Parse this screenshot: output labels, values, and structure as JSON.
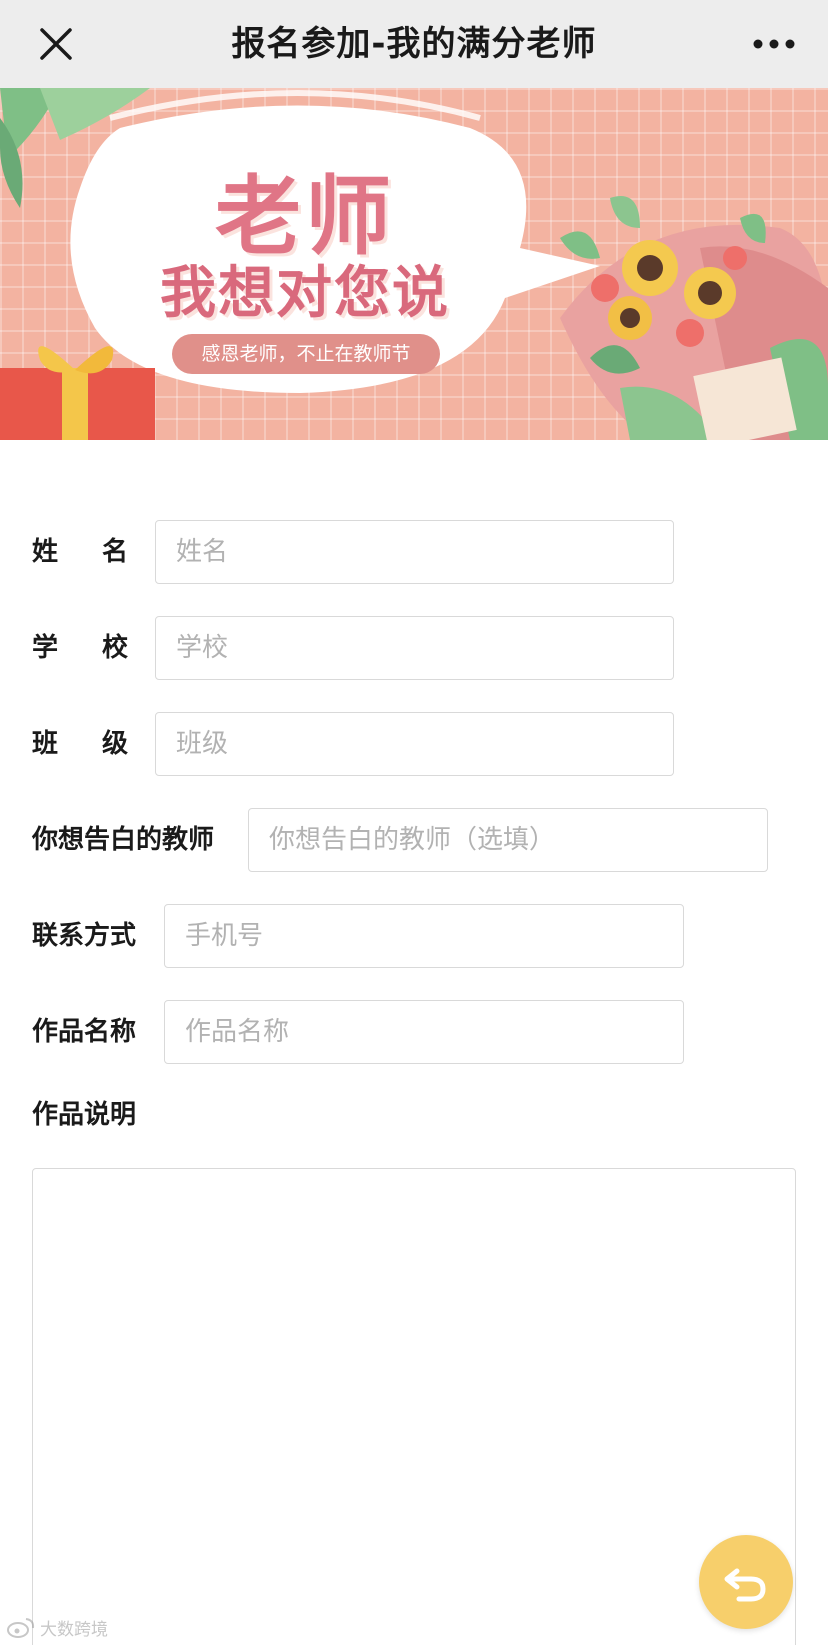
{
  "nav": {
    "title": "报名参加-我的满分老师",
    "close_icon": "close-icon",
    "more_icon": "more-dots-icon"
  },
  "banner": {
    "title": "老师",
    "subtitle": "我想对您说",
    "tagline": "感恩老师，不止在教师节",
    "colors": {
      "background": "#f3b3a1",
      "title": "#e07586",
      "tag": "#e0908a"
    }
  },
  "form": {
    "name": {
      "label": "姓名",
      "placeholder": "姓名",
      "value": ""
    },
    "school": {
      "label": "学校",
      "placeholder": "学校",
      "value": ""
    },
    "class": {
      "label": "班级",
      "placeholder": "班级",
      "value": ""
    },
    "teacher": {
      "label": "你想告白的教师",
      "placeholder": "你想告白的教师（选填）",
      "value": ""
    },
    "contact": {
      "label": "联系方式",
      "placeholder": "手机号",
      "value": ""
    },
    "work_name": {
      "label": "作品名称",
      "placeholder": "作品名称",
      "value": ""
    },
    "work_desc": {
      "label": "作品说明",
      "value": ""
    }
  },
  "fab": {
    "icon": "back-arrow-icon",
    "color": "#f7cf6b"
  },
  "watermark": {
    "text": "大数跨境",
    "icon": "weibo-icon"
  }
}
